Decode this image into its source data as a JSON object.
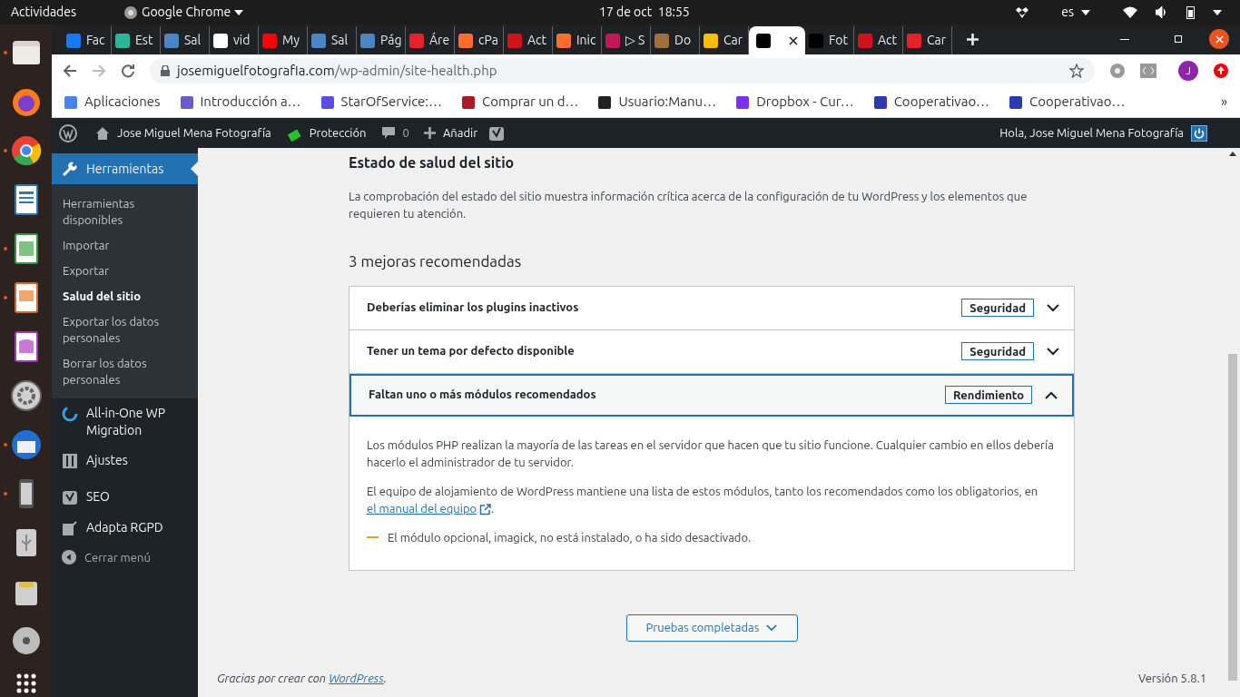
{
  "topbar": {
    "activities": "Actividades",
    "app": "Google Chrome",
    "clock": "17 de oct  18:55",
    "language": "es"
  },
  "dock": [
    {
      "kind": "folder",
      "running": true
    },
    {
      "kind": "firefox",
      "running": false
    },
    {
      "kind": "chrome",
      "running": true
    },
    {
      "kind": "writer",
      "running": false
    },
    {
      "kind": "calc",
      "running": true
    },
    {
      "kind": "impress",
      "running": true
    },
    {
      "kind": "base",
      "running": false
    },
    {
      "kind": "gear",
      "running": false
    },
    {
      "kind": "mail",
      "running": true
    },
    {
      "kind": "phone",
      "running": true
    },
    {
      "kind": "usb",
      "running": false
    },
    {
      "kind": "drive",
      "running": false
    },
    {
      "kind": "disc",
      "running": false
    },
    {
      "kind": "grid",
      "running": false
    }
  ],
  "tabs": [
    {
      "label": "Fac",
      "color": "#1877f2",
      "selected": false
    },
    {
      "label": "Est",
      "color": "#2bb59a",
      "selected": false
    },
    {
      "label": "Sal",
      "color": "#4a86c5",
      "selected": false
    },
    {
      "label": "vid",
      "color": "#ffffff",
      "selected": false
    },
    {
      "label": "My",
      "color": "#ff0000",
      "selected": false
    },
    {
      "label": "Sal",
      "color": "#4a86c5",
      "selected": false
    },
    {
      "label": "Pág",
      "color": "#4a86c5",
      "selected": false
    },
    {
      "label": "Áre",
      "color": "#e8202a",
      "selected": false
    },
    {
      "label": "cPa",
      "color": "#ff6c2c",
      "selected": false
    },
    {
      "label": "Act",
      "color": "#d0121a",
      "selected": false
    },
    {
      "label": "Inic",
      "color": "#ff6c2c",
      "selected": false
    },
    {
      "label": "▷ S",
      "color": "#c2185b",
      "selected": false
    },
    {
      "label": "Do",
      "color": "#a0703a",
      "selected": false
    },
    {
      "label": "Car",
      "color": "#fbbc04",
      "selected": false
    },
    {
      "color": "#000000",
      "selected": true
    },
    {
      "label": "Fot",
      "color": "#000000",
      "selected": false
    },
    {
      "label": "Act",
      "color": "#d0121a",
      "selected": false
    },
    {
      "label": "Car",
      "color": "#e8202a",
      "selected": false
    }
  ],
  "address": {
    "host": "josemiguelfotografia.com",
    "path": "/wp-admin/site-health.php",
    "avatar": "J"
  },
  "bookmarks": [
    {
      "label": "Aplicaciones",
      "color": "#4285f4"
    },
    {
      "label": "Introducción a…",
      "color": "#6a5acd"
    },
    {
      "label": "StarOfService:…",
      "color": "#5b4fe0"
    },
    {
      "label": "Comprar un d…",
      "color": "#b0182a"
    },
    {
      "label": "Usuario:Manu…",
      "color": "#222222"
    },
    {
      "label": "Dropbox - Cur…",
      "color": "#7b2ff7"
    },
    {
      "label": "Cooperativao…",
      "color": "#2a3bb5"
    },
    {
      "label": "Cooperativao…",
      "color": "#2a3bb5"
    }
  ],
  "bookmarks_more": "»",
  "adminbar": {
    "site": "Jose Miguel Mena Fotografía",
    "protection": "Protección",
    "comments": "0",
    "add": "Añadir",
    "greeting": "Hola, Jose Miguel Mena Fotografía"
  },
  "sidebar": {
    "current": "Herramientas",
    "submenu": [
      {
        "label": "Herramientas disponibles",
        "selected": false
      },
      {
        "label": "Importar",
        "selected": false
      },
      {
        "label": "Exportar",
        "selected": false
      },
      {
        "label": "Salud del sitio",
        "selected": true
      },
      {
        "label": "Exportar los datos personales",
        "selected": false
      },
      {
        "label": "Borrar los datos personales",
        "selected": false
      }
    ],
    "items": [
      {
        "kind": "migration",
        "label": "All-in-One WP Migration"
      },
      {
        "kind": "settings",
        "label": "Ajustes"
      },
      {
        "kind": "seo",
        "label": "SEO"
      },
      {
        "kind": "edit",
        "label": "Adapta RGPD"
      },
      {
        "kind": "collapse",
        "label": "Cerrar menú"
      }
    ]
  },
  "content": {
    "title": "Estado de salud del sitio",
    "intro": "La comprobación del estado del sitio muestra información crítica acerca de la configuración de tu WordPress y los elementos que requieren tu atención.",
    "count": "3 mejoras recomendadas",
    "issues": [
      {
        "title": "Deberías eliminar los plugins inactivos",
        "badge": "Seguridad",
        "expanded": false
      },
      {
        "title": "Tener un tema por defecto disponible",
        "badge": "Seguridad",
        "expanded": false
      },
      {
        "title": "Faltan uno o más módulos recomendados",
        "badge": "Rendimiento",
        "expanded": true,
        "body": {
          "p1": "Los módulos PHP realizan la mayoría de las tareas en el servidor que hacen que tu sitio funcione. Cualquier cambio en ellos debería hacerlo el administrador de tu servidor.",
          "p2": "El equipo de alojamiento de WordPress mantiene una lista de estos módulos, tanto los recomendados como los obligatorios, en",
          "link": "el manual del equipo",
          "p2_end": ".",
          "warning": "El módulo opcional, imagick, no está instalado, o ha sido desactivado."
        }
      }
    ],
    "tests_button": "Pruebas completadas"
  },
  "footer": {
    "thanks": "Gracias por crear con",
    "link": "WordPress",
    "end": ".",
    "version": "Versión 5.8.1"
  }
}
